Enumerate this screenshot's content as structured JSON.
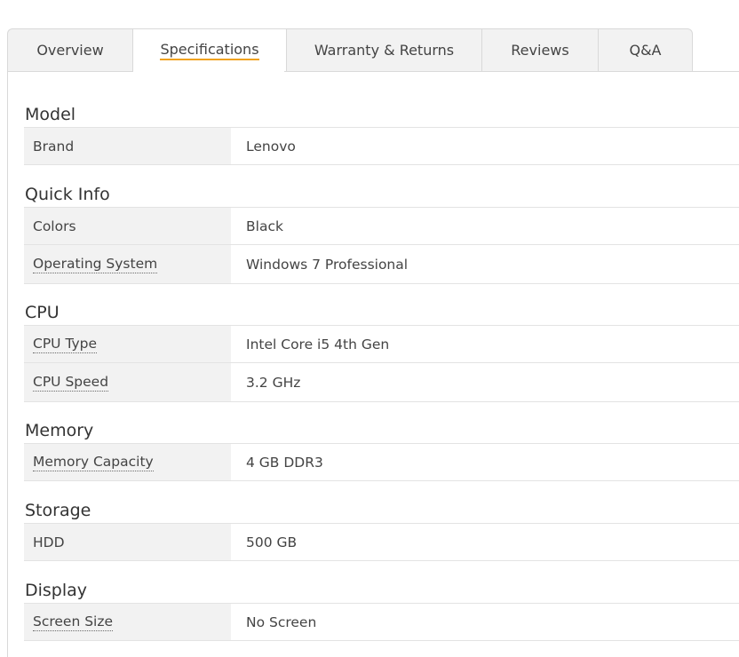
{
  "tabs": [
    {
      "label": "Overview",
      "active": false
    },
    {
      "label": "Specifications",
      "active": true
    },
    {
      "label": "Warranty & Returns",
      "active": false
    },
    {
      "label": "Reviews",
      "active": false
    },
    {
      "label": "Q&A",
      "active": false
    }
  ],
  "colors": {
    "accent_underline": "#f0a11e",
    "key_background": "#f2f2f2",
    "border": "#e3e3e3"
  },
  "sections": [
    {
      "title": "Model",
      "rows": [
        {
          "key": "Brand",
          "value": "Lenovo",
          "has_tooltip": false
        }
      ]
    },
    {
      "title": "Quick Info",
      "rows": [
        {
          "key": "Colors",
          "value": "Black",
          "has_tooltip": false
        },
        {
          "key": "Operating System",
          "value": "Windows 7 Professional",
          "has_tooltip": true
        }
      ]
    },
    {
      "title": "CPU",
      "rows": [
        {
          "key": "CPU Type",
          "value": "Intel Core i5 4th Gen",
          "has_tooltip": true
        },
        {
          "key": "CPU Speed",
          "value": "3.2 GHz",
          "has_tooltip": true
        }
      ]
    },
    {
      "title": "Memory",
      "rows": [
        {
          "key": "Memory Capacity",
          "value": "4 GB DDR3",
          "has_tooltip": true
        }
      ]
    },
    {
      "title": "Storage",
      "rows": [
        {
          "key": "HDD",
          "value": "500 GB",
          "has_tooltip": false
        }
      ]
    },
    {
      "title": "Display",
      "rows": [
        {
          "key": "Screen Size",
          "value": "No Screen",
          "has_tooltip": true
        }
      ]
    }
  ]
}
